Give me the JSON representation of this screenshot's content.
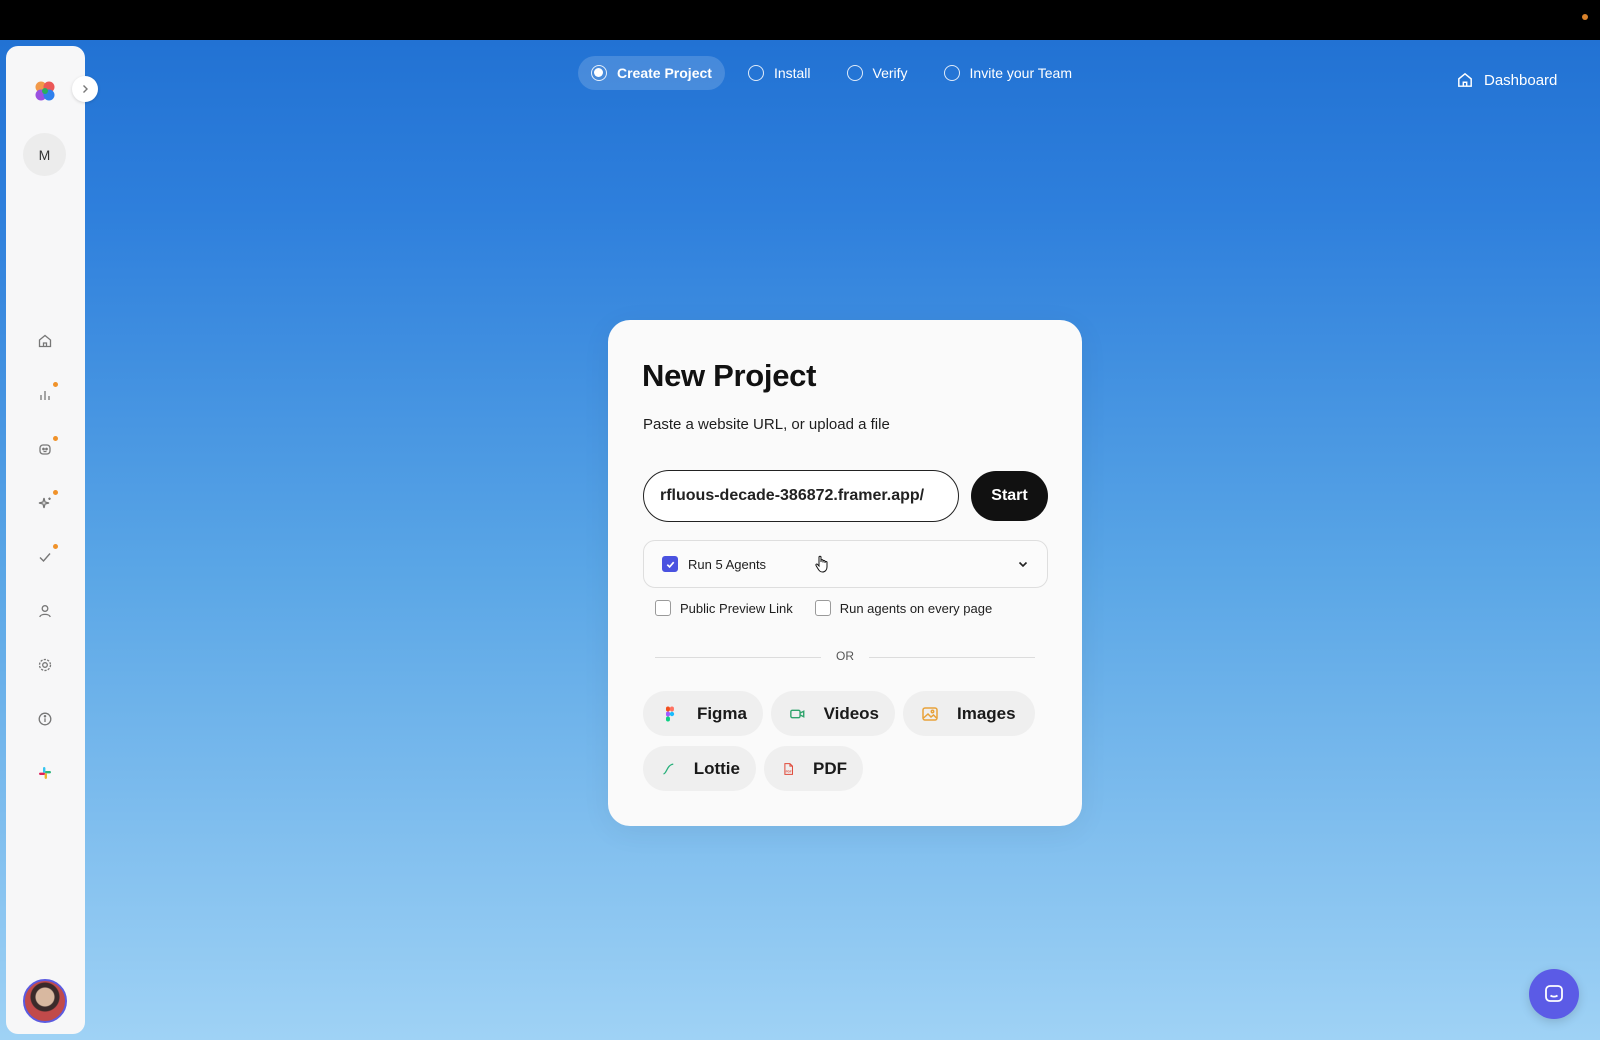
{
  "steps": [
    {
      "label": "Create Project",
      "active": true
    },
    {
      "label": "Install",
      "active": false
    },
    {
      "label": "Verify",
      "active": false
    },
    {
      "label": "Invite your Team",
      "active": false
    }
  ],
  "header": {
    "dashboard_label": "Dashboard"
  },
  "sidebar": {
    "workspace_initial": "M",
    "items": [
      {
        "icon": "home-icon",
        "badge": false
      },
      {
        "icon": "bar-chart-icon",
        "badge": true
      },
      {
        "icon": "bot-icon",
        "badge": true
      },
      {
        "icon": "sparkles-icon",
        "badge": true
      },
      {
        "icon": "check-icon",
        "badge": true
      },
      {
        "icon": "user-icon",
        "badge": false
      },
      {
        "icon": "gear-icon",
        "badge": false
      },
      {
        "icon": "info-icon",
        "badge": false
      },
      {
        "icon": "slack-icon",
        "badge": false
      }
    ]
  },
  "card": {
    "title": "New Project",
    "subtitle": "Paste a website URL, or upload a file",
    "url_value": "rfluous-decade-386872.framer.app/",
    "start_label": "Start",
    "agents_label": "Run 5 Agents",
    "agents_checked": true,
    "options": [
      {
        "label": "Public Preview Link",
        "checked": false
      },
      {
        "label": "Run agents on every page",
        "checked": false
      }
    ],
    "divider_text": "OR",
    "sources": [
      {
        "label": "Figma",
        "icon": "figma-icon"
      },
      {
        "label": "Videos",
        "icon": "video-icon"
      },
      {
        "label": "Images",
        "icon": "image-icon"
      },
      {
        "label": "Lottie",
        "icon": "lottie-icon"
      },
      {
        "label": "PDF",
        "icon": "pdf-icon"
      }
    ]
  },
  "colors": {
    "accent": "#4a52e0",
    "badge": "#f0922a",
    "chat_button": "#5b5be6"
  }
}
